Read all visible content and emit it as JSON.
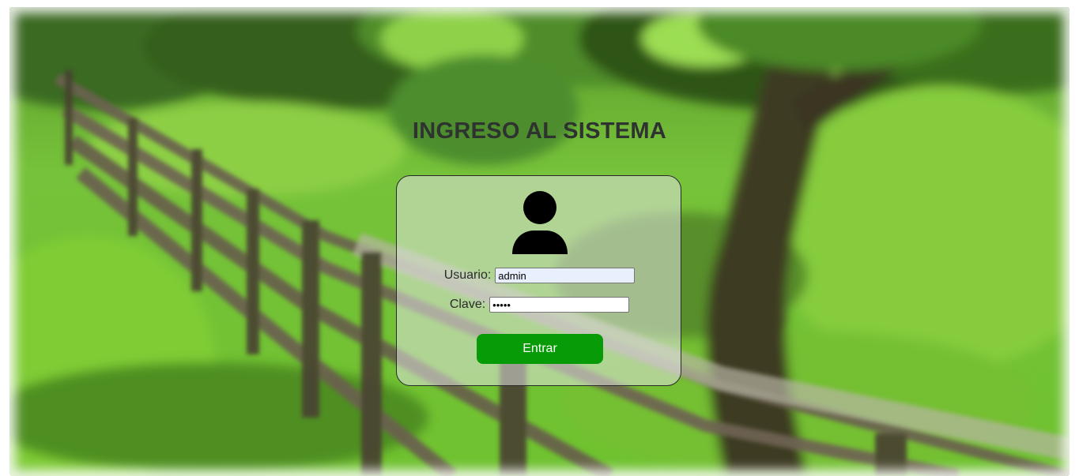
{
  "page": {
    "title": "INGRESO AL SISTEMA"
  },
  "login_form": {
    "avatar_icon": "user-icon",
    "username_label": "Usuario:",
    "username_value": "admin",
    "password_label": "Clave:",
    "password_value": "•••••",
    "submit_label": "Entrar"
  },
  "colors": {
    "submit_button": "#079b07",
    "title_text": "#2e3330",
    "card_border": "#2a2a2a"
  },
  "background": {
    "description_icon": "landscape-background"
  }
}
